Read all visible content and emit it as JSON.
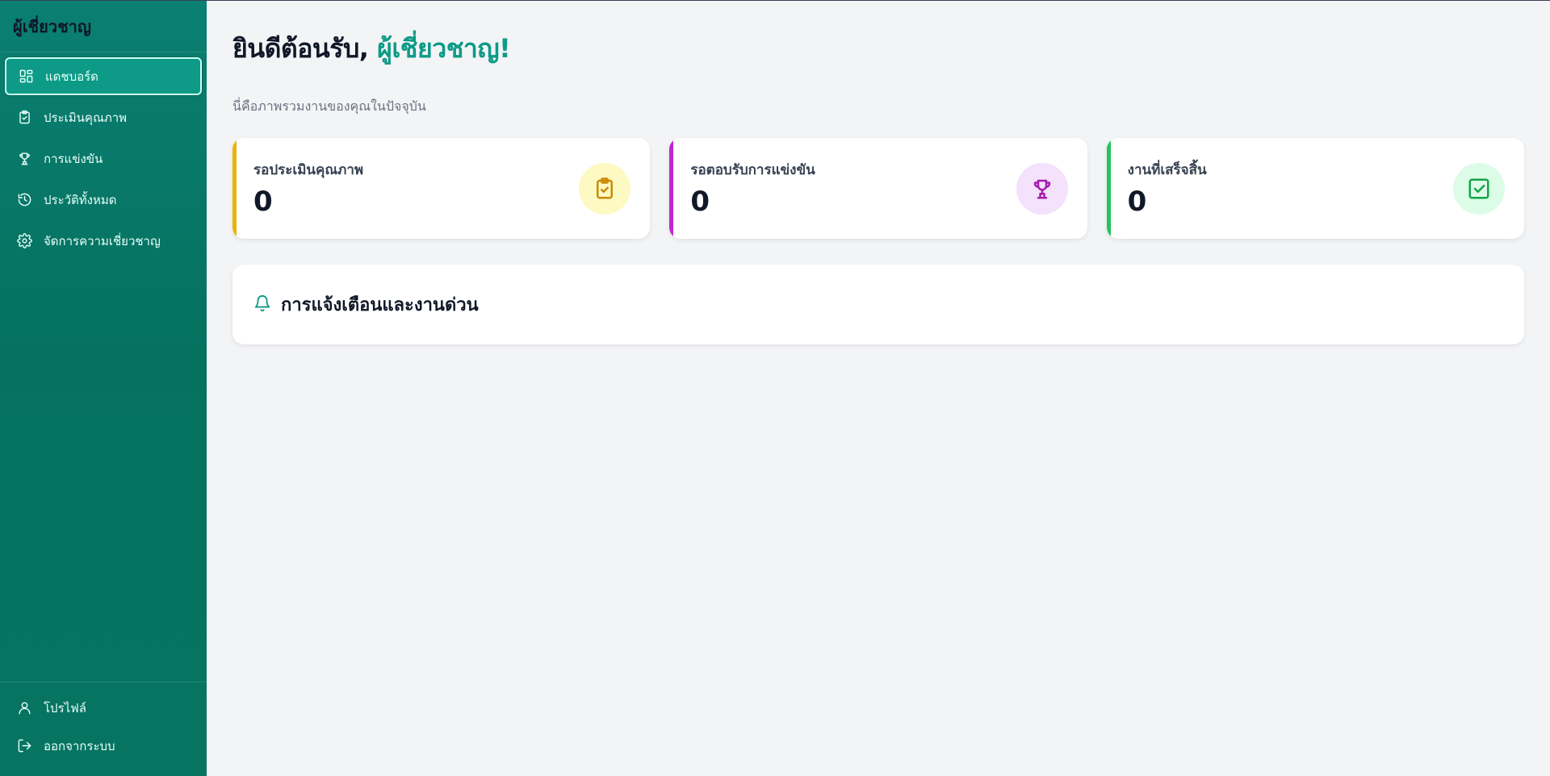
{
  "sidebar": {
    "brand": "ผู้เชี่ยวชาญ",
    "items": [
      {
        "label": "แดชบอร์ด",
        "icon": "dashboard-icon",
        "active": true
      },
      {
        "label": "ประเมินคุณภาพ",
        "icon": "clipboard-check-icon"
      },
      {
        "label": "การแข่งขัน",
        "icon": "trophy-icon"
      },
      {
        "label": "ประวัติทั้งหมด",
        "icon": "history-icon"
      },
      {
        "label": "จัดการความเชี่ยวชาญ",
        "icon": "gear-icon"
      }
    ],
    "bottom": [
      {
        "label": "โปรไฟล์",
        "icon": "user-icon"
      },
      {
        "label": "ออกจากระบบ",
        "icon": "logout-icon"
      }
    ]
  },
  "main": {
    "welcome_prefix": "ยินดีต้อนรับ, ",
    "welcome_name": "ผู้เชี่ยวชาญ!",
    "subtitle": "นี่คือภาพรวมงานของคุณในปัจจุบัน",
    "cards": [
      {
        "label": "รอประเมินคุณภาพ",
        "value": "0",
        "color": "#eab308",
        "icon": "clipboard-check-icon"
      },
      {
        "label": "รอตอบรับการแข่งขัน",
        "value": "0",
        "color": "#c026d3",
        "icon": "trophy-icon"
      },
      {
        "label": "งานที่เสร็จสิ้น",
        "value": "0",
        "color": "#22c55e",
        "icon": "check-square-icon"
      }
    ],
    "alerts": {
      "title": "การแจ้งเตือนและงานด่วน",
      "icon": "bell-icon"
    }
  },
  "colors": {
    "sidebar_bg": "#077462",
    "accent": "#0d9b87"
  }
}
